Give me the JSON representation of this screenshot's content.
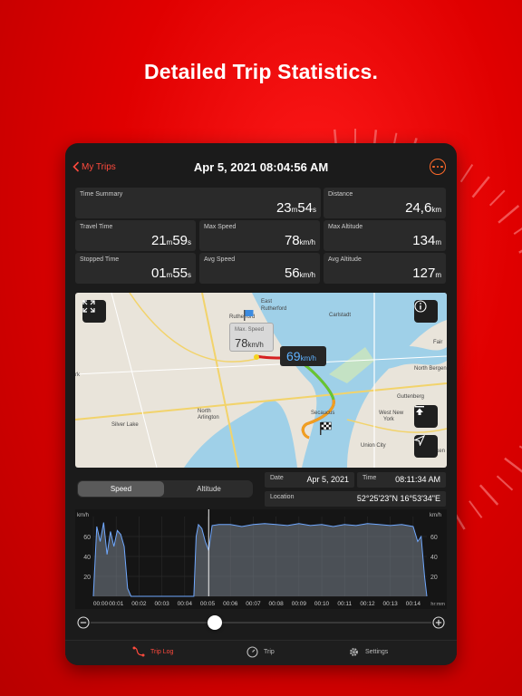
{
  "headline": "Detailed Trip Statistics.",
  "nav": {
    "back_label": "My Trips",
    "title": "Apr 5, 2021 08:04:56 AM"
  },
  "stats": {
    "time_summary": {
      "label": "Time Summary",
      "a": "23",
      "a_unit": "m",
      "b": "54",
      "b_unit": "s"
    },
    "distance": {
      "label": "Distance",
      "value": "24,6",
      "unit": "km"
    },
    "travel_time": {
      "label": "Travel Time",
      "a": "21",
      "a_unit": "m",
      "b": "59",
      "b_unit": "s"
    },
    "max_speed": {
      "label": "Max Speed",
      "value": "78",
      "unit": "km/h"
    },
    "max_altitude": {
      "label": "Max Altitude",
      "value": "134",
      "unit": "m"
    },
    "stopped_time": {
      "label": "Stopped Time",
      "a": "01",
      "a_unit": "m",
      "b": "55",
      "b_unit": "s"
    },
    "avg_speed": {
      "label": "Avg Speed",
      "value": "56",
      "unit": "km/h"
    },
    "avg_altitude": {
      "label": "Avg Altitude",
      "value": "127",
      "unit": "m"
    }
  },
  "map": {
    "places": [
      "East",
      "Rutherford",
      "Carlstadt",
      "Secaucus",
      "North",
      "Arlington",
      "Silver Lake",
      "West New",
      "York",
      "Guttenberg",
      "North Bergen",
      "Union City",
      "Weehawken",
      "Fair",
      "rk",
      "Rutherford"
    ],
    "max_bubble": {
      "title": "Max. Speed",
      "value": "78",
      "unit": "km/h"
    },
    "current_bubble": {
      "value": "69",
      "unit": "km/h"
    }
  },
  "segment": {
    "speed": "Speed",
    "altitude": "Altitude"
  },
  "info": {
    "date_label": "Date",
    "date_value": "Apr 5, 2021",
    "time_label": "Time",
    "time_value": "08:11:34 AM",
    "location_label": "Location",
    "location_value": "52°25'23\"N 16°53'34\"E"
  },
  "chart_data": {
    "type": "area",
    "y_unit": "km/h",
    "x_unit": "hr:mm",
    "y_ticks": [
      "60",
      "40",
      "20"
    ],
    "ylim": [
      0,
      80
    ],
    "x_ticks": [
      "00:00",
      "00:01",
      "00:02",
      "00:03",
      "00:04",
      "00:05",
      "00:06",
      "00:07",
      "00:08",
      "00:09",
      "00:10",
      "00:11",
      "00:12",
      "00:13",
      "00:14"
    ],
    "x": [
      0,
      0.15,
      0.3,
      0.45,
      0.6,
      0.75,
      0.9,
      1.05,
      1.2,
      1.35,
      1.5,
      1.65,
      1.8,
      4.4,
      4.5,
      4.6,
      4.75,
      4.9,
      5.05,
      5.2,
      5.5,
      6,
      6.5,
      7,
      7.5,
      8,
      8.5,
      9,
      9.5,
      10,
      10.5,
      11,
      11.5,
      12,
      12.5,
      13,
      13.5,
      14,
      14.2,
      14.35,
      14.5,
      14.6
    ],
    "values": [
      0,
      70,
      55,
      74,
      42,
      65,
      50,
      66,
      62,
      50,
      8,
      0,
      0,
      0,
      60,
      72,
      68,
      55,
      46,
      71,
      72,
      72,
      70,
      72,
      73,
      72,
      71,
      73,
      71,
      72,
      70,
      72,
      71,
      73,
      72,
      71,
      72,
      70,
      55,
      60,
      20,
      0
    ],
    "cursor_x": 5.05
  },
  "tabs": {
    "trip_log": "Trip Log",
    "trip": "Trip",
    "settings": "Settings"
  },
  "colors": {
    "accent": "#ff4a3d",
    "speed_blue": "#5fb2ff",
    "background_red": "#e00000"
  }
}
